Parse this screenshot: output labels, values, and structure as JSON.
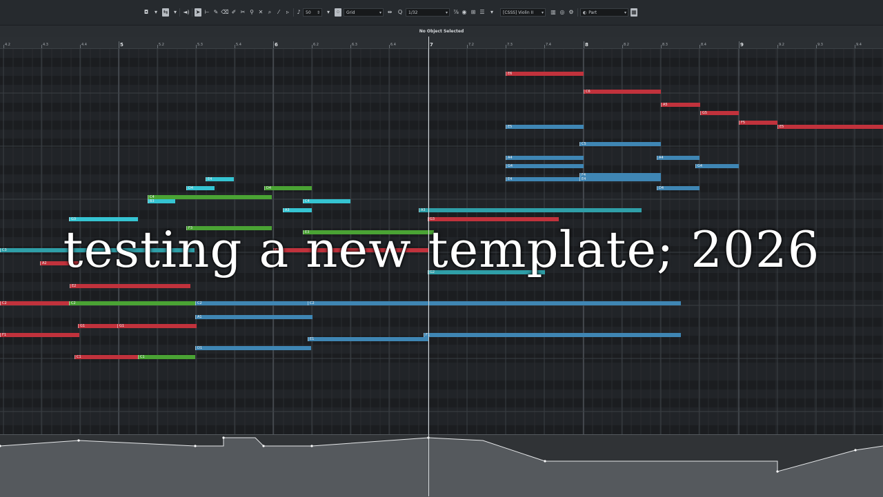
{
  "toolbar": {
    "quantize_value": "50",
    "snap_type": "Grid",
    "quantize_grid": "1/32",
    "track_name": "[CSSS] Violin II",
    "part_selector": "Part"
  },
  "info_line": {
    "status": "No Object Selected"
  },
  "ruler": {
    "ticks": [
      {
        "label": "4.2",
        "bar": false
      },
      {
        "label": "4.3",
        "bar": false
      },
      {
        "label": "4.4",
        "bar": false
      },
      {
        "label": "5",
        "bar": true
      },
      {
        "label": "5.2",
        "bar": false
      },
      {
        "label": "5.3",
        "bar": false
      },
      {
        "label": "5.4",
        "bar": false
      },
      {
        "label": "6",
        "bar": true
      },
      {
        "label": "6.2",
        "bar": false
      },
      {
        "label": "6.3",
        "bar": false
      },
      {
        "label": "6.4",
        "bar": false
      },
      {
        "label": "7",
        "bar": true
      },
      {
        "label": "7.2",
        "bar": false
      },
      {
        "label": "7.3",
        "bar": false
      },
      {
        "label": "7.4",
        "bar": false
      },
      {
        "label": "8",
        "bar": true
      },
      {
        "label": "8.2",
        "bar": false
      },
      {
        "label": "8.3",
        "bar": false
      },
      {
        "label": "8.4",
        "bar": false
      },
      {
        "label": "9",
        "bar": true
      },
      {
        "label": "9.2",
        "bar": false
      },
      {
        "label": "9.3",
        "bar": false
      },
      {
        "label": "9.4",
        "bar": false
      }
    ]
  },
  "colors": {
    "red": "#c1323c",
    "blue": "#3f86b4",
    "green": "#4aa334",
    "cyan": "#35c4d2",
    "teal": "#2f9fa8"
  },
  "notes": [
    {
      "label": "E6",
      "color": "red"
    },
    {
      "label": "C6",
      "color": "red"
    },
    {
      "label": "A5",
      "color": "red"
    },
    {
      "label": "G5",
      "color": "red"
    },
    {
      "label": "F5",
      "color": "red"
    },
    {
      "label": "E5",
      "color": "red"
    },
    {
      "label": "E5",
      "color": "blue"
    },
    {
      "label": "C5",
      "color": "blue"
    },
    {
      "label": "A4",
      "color": "blue"
    },
    {
      "label": "A4",
      "color": "blue"
    },
    {
      "label": "G4",
      "color": "blue"
    },
    {
      "label": "G4",
      "color": "blue"
    },
    {
      "label": "F4",
      "color": "blue"
    },
    {
      "label": "E4",
      "color": "blue"
    },
    {
      "label": "E4",
      "color": "blue"
    },
    {
      "label": "D4",
      "color": "blue"
    },
    {
      "label": "E4",
      "color": "cyan"
    },
    {
      "label": "D4",
      "color": "cyan"
    },
    {
      "label": "D4",
      "color": "green"
    },
    {
      "label": "C4",
      "color": "green"
    },
    {
      "label": "C4",
      "color": "cyan"
    },
    {
      "label": "B3",
      "color": "cyan"
    },
    {
      "label": "A3",
      "color": "cyan"
    },
    {
      "label": "A3",
      "color": "teal"
    },
    {
      "label": "G3",
      "color": "cyan"
    },
    {
      "label": "G3",
      "color": "red"
    },
    {
      "label": "F3",
      "color": "green"
    },
    {
      "label": "E3",
      "color": "green"
    },
    {
      "label": "C3",
      "color": "teal"
    },
    {
      "label": "C3",
      "color": "red"
    },
    {
      "label": "A2",
      "color": "red"
    },
    {
      "label": "G2",
      "color": "teal"
    },
    {
      "label": "E2",
      "color": "red"
    },
    {
      "label": "C2",
      "color": "red"
    },
    {
      "label": "C2",
      "color": "green"
    },
    {
      "label": "C2",
      "color": "blue"
    },
    {
      "label": "C2",
      "color": "blue"
    },
    {
      "label": "A1",
      "color": "blue"
    },
    {
      "label": "G1",
      "color": "red"
    },
    {
      "label": "G1",
      "color": "red"
    },
    {
      "label": "F1",
      "color": "red"
    },
    {
      "label": "F1",
      "color": "blue"
    },
    {
      "label": "E1",
      "color": "blue"
    },
    {
      "label": "D1",
      "color": "blue"
    },
    {
      "label": "C1",
      "color": "red"
    },
    {
      "label": "C1",
      "color": "green"
    }
  ],
  "overlay": {
    "title": "testing a new template; 2026"
  }
}
